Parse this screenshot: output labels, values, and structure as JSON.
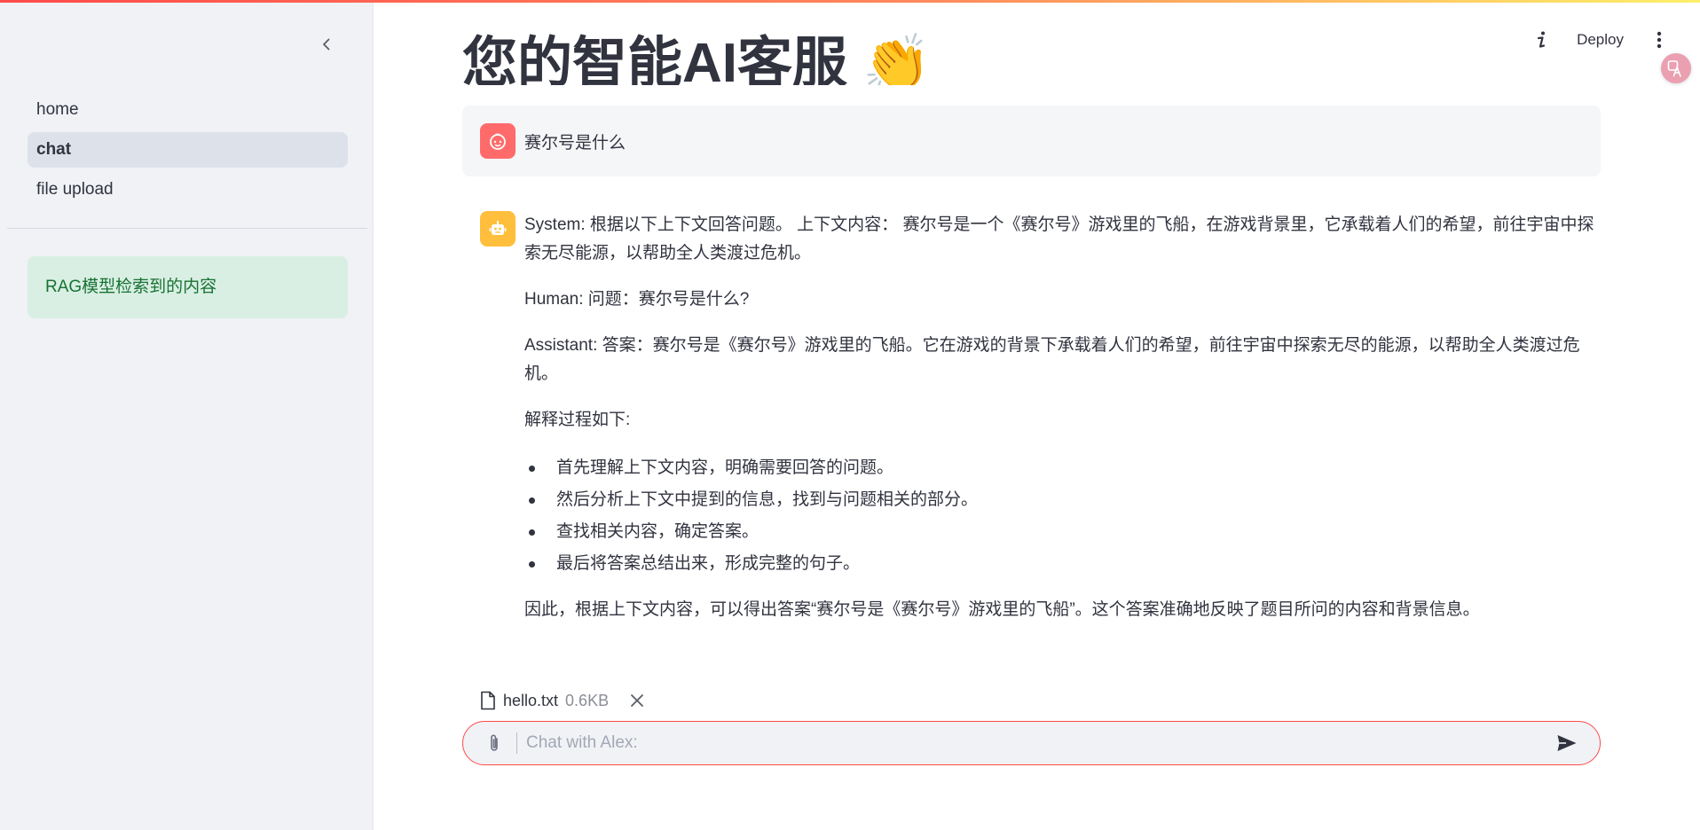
{
  "colors": {
    "accent": "#ff4b4b",
    "sidebar_bg": "#f0f2f6",
    "success_bg": "#d9efe3",
    "success_text": "#177233",
    "user_avatar": "#ff6b6b",
    "bot_avatar": "#ffbe3c"
  },
  "sidebar": {
    "collapse_icon": "chevron-left-icon",
    "nav": [
      {
        "label": "home",
        "active": false
      },
      {
        "label": "chat",
        "active": true
      },
      {
        "label": "file upload",
        "active": false
      }
    ],
    "rag_notice": "RAG模型检索到的内容"
  },
  "header": {
    "info_icon": "info-icon",
    "deploy_label": "Deploy",
    "menu_icon": "more-vertical-icon",
    "translate_icon": "translate-icon"
  },
  "main": {
    "title": "您的智能AI客服 👏"
  },
  "messages": {
    "user": {
      "avatar_icon": "user-face-icon",
      "text": "赛尔号是什么"
    },
    "assistant": {
      "avatar_icon": "robot-icon",
      "para1": "System: 根据以下上下文回答问题。 上下文内容： 赛尔号是一个《赛尔号》游戏里的飞船，在游戏背景里，它承载着人们的希望，前往宇宙中探索无尽能源，以帮助全人类渡过危机。",
      "para2": "Human: 问题：赛尔号是什么?",
      "para3": "Assistant: 答案：赛尔号是《赛尔号》游戏里的飞船。它在游戏的背景下承载着人们的希望，前往宇宙中探索无尽的能源，以帮助全人类渡过危机。",
      "para4": "解释过程如下:",
      "bullets": [
        "首先理解上下文内容，明确需要回答的问题。",
        "然后分析上下文中提到的信息，找到与问题相关的部分。",
        "查找相关内容，确定答案。",
        "最后将答案总结出来，形成完整的句子。"
      ],
      "para5": "因此，根据上下文内容，可以得出答案“赛尔号是《赛尔号》游戏里的飞船”。这个答案准确地反映了题目所问的内容和背景信息。"
    }
  },
  "attachment": {
    "file_icon": "file-icon",
    "name": "hello.txt",
    "size": "0.6KB",
    "remove_icon": "close-icon"
  },
  "chat_input": {
    "attach_icon": "paperclip-icon",
    "placeholder": "Chat with Alex:",
    "value": "",
    "send_icon": "send-icon"
  }
}
